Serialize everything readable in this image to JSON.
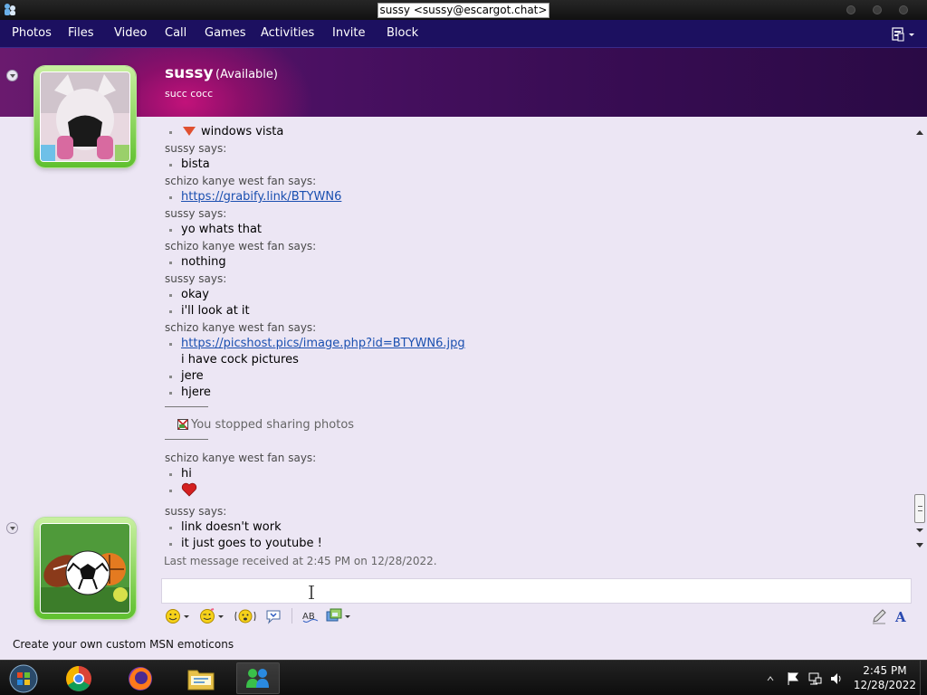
{
  "window": {
    "title": "sussy <sussy@escargot.chat>"
  },
  "menu": [
    "Photos",
    "Files",
    "Video",
    "Call",
    "Games",
    "Activities",
    "Invite",
    "Block"
  ],
  "contact": {
    "name": "sussy",
    "status": "(Available)",
    "message": "succ cocc"
  },
  "chat": {
    "messages": [
      {
        "kind": "msg",
        "text": "windows vista",
        "icon": "down-arrow-icon"
      },
      {
        "kind": "says",
        "text": "sussy says:"
      },
      {
        "kind": "msg",
        "text": "bista"
      },
      {
        "kind": "says",
        "text": "schizo kanye west fan says:"
      },
      {
        "kind": "link",
        "text": "https://grabify.link/BTYWN6"
      },
      {
        "kind": "says",
        "text": "sussy says:"
      },
      {
        "kind": "msg",
        "text": "yo whats that"
      },
      {
        "kind": "says",
        "text": "schizo kanye west fan says:"
      },
      {
        "kind": "msg",
        "text": "nothing"
      },
      {
        "kind": "says",
        "text": "sussy says:"
      },
      {
        "kind": "msg",
        "text": "okay"
      },
      {
        "kind": "msg",
        "text": "i'll look at it"
      },
      {
        "kind": "says",
        "text": "schizo kanye west fan says:"
      },
      {
        "kind": "link",
        "text": "https://picshost.pics/image.php?id=BTYWN6.jpg"
      },
      {
        "kind": "msg",
        "text": "i have cock pictures",
        "nobullet": true
      },
      {
        "kind": "msg",
        "text": "jere"
      },
      {
        "kind": "msg",
        "text": "hjere"
      },
      {
        "kind": "system",
        "text": "You stopped sharing photos"
      },
      {
        "kind": "says",
        "text": "schizo kanye west fan says:"
      },
      {
        "kind": "msg",
        "text": "hi"
      },
      {
        "kind": "emoticon",
        "icon": "heart-icon"
      },
      {
        "kind": "says",
        "text": "sussy says:"
      },
      {
        "kind": "msg",
        "text": "link doesn't work"
      },
      {
        "kind": "msg",
        "text": "it just goes to youtube !"
      }
    ],
    "last_message": "Last message received at 2:45 PM on 12/28/2022."
  },
  "input": {
    "value": ""
  },
  "footer": {
    "link": "Create your own custom MSN emoticons"
  },
  "clock": {
    "time": "2:45 PM",
    "date": "12/28/2022"
  },
  "colors": {
    "menubar": "#1c1060",
    "link": "#1a4fb0",
    "avatar_frame": "#5fc02e"
  }
}
